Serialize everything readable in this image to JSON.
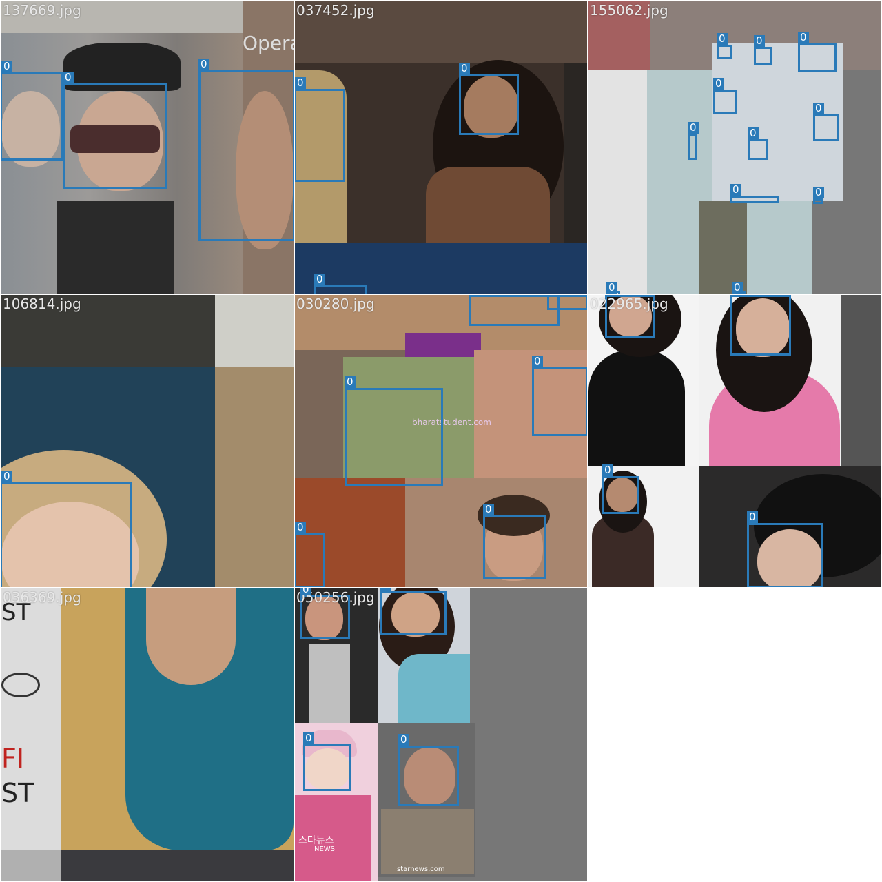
{
  "class_label": "0",
  "box_color": "#2a7ab8",
  "tiles": [
    {
      "filename": "137669.jpg",
      "overlay_text": "Opera",
      "box_count": 3
    },
    {
      "filename": "037452.jpg",
      "box_count": 4
    },
    {
      "filename": "155062.jpg",
      "box_count": 13
    },
    {
      "filename": "106814.jpg",
      "box_count": 1
    },
    {
      "filename": "030280.jpg",
      "watermark": "bharatstudent.com",
      "box_count": 6
    },
    {
      "filename": "022965.jpg",
      "box_count": 4
    },
    {
      "filename": "036369.jpg",
      "sign_text": [
        "ST",
        "FI",
        "ST"
      ],
      "box_count": 0
    },
    {
      "filename": "050256.jpg",
      "watermark_lines": [
        "스타뉴스",
        "NEWS",
        "starnews.com"
      ],
      "box_count": 5
    }
  ]
}
